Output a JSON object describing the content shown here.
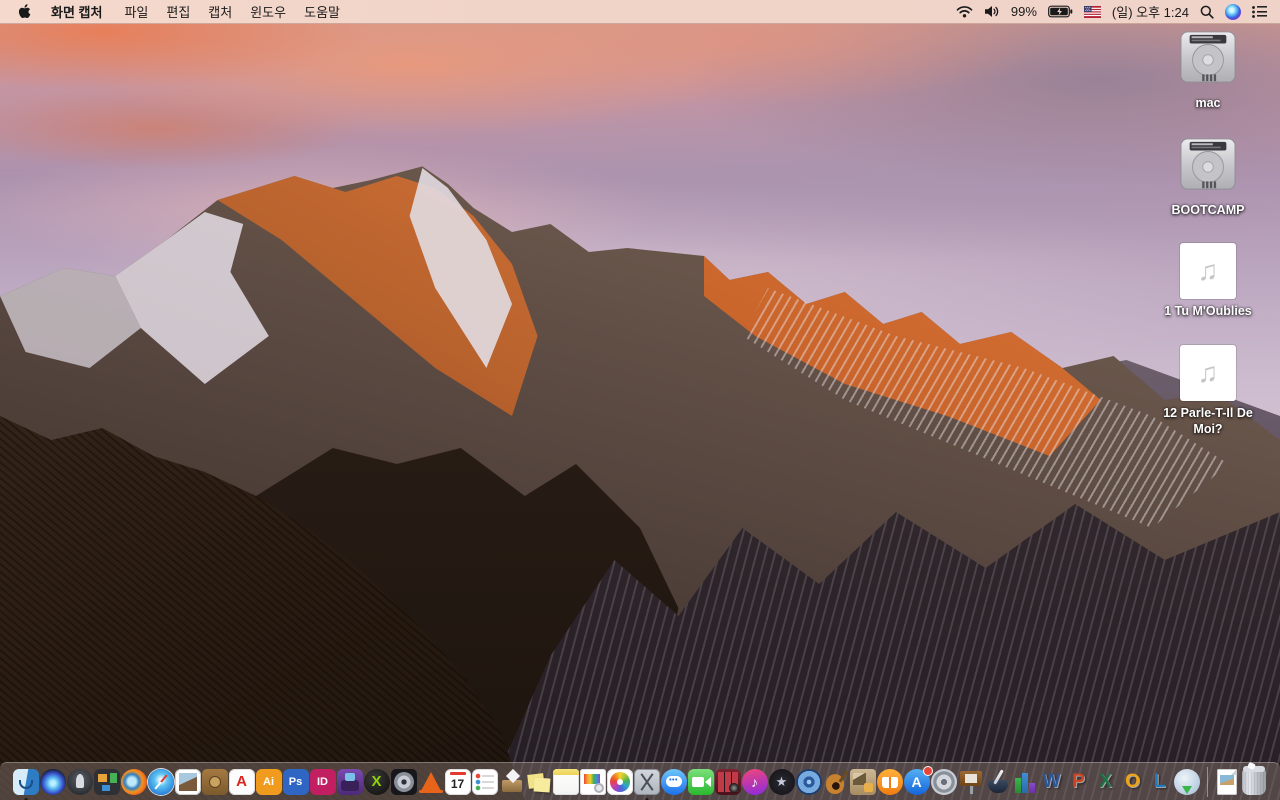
{
  "menu_bar": {
    "apple_logo_icon": "apple-logo",
    "app_name": "화면 캡처",
    "menus": [
      {
        "name": "file",
        "label": "파일"
      },
      {
        "name": "edit",
        "label": "편집"
      },
      {
        "name": "capture",
        "label": "캡처"
      },
      {
        "name": "window",
        "label": "윈도우"
      },
      {
        "name": "help",
        "label": "도움말"
      }
    ],
    "status": {
      "wifi_icon": "wifi",
      "volume_icon": "volume-on",
      "battery_percent": "99%",
      "battery_icon": "battery-charging",
      "input_source_icon": "us-flag",
      "clock": "(일) 오후 1:24",
      "search_icon": "spotlight-magnifier",
      "siri_icon": "siri-orb",
      "notification_icon": "notification-center-list"
    }
  },
  "desktop": {
    "icons": [
      {
        "name": "mac-drive",
        "label": "mac",
        "type": "hard-drive"
      },
      {
        "name": "bootcamp-drive",
        "label": "BOOTCAMP",
        "type": "hard-drive"
      },
      {
        "name": "audio-file-1",
        "label": "1 Tu M'Oublies",
        "type": "audio-file",
        "glyph": "♫"
      },
      {
        "name": "audio-file-2",
        "label": "12 Parle-T-Il De Moi?",
        "type": "audio-file",
        "glyph": "♫"
      }
    ]
  },
  "dock": {
    "items": [
      {
        "name": "finder",
        "running": true
      },
      {
        "name": "siri"
      },
      {
        "name": "launchpad"
      },
      {
        "name": "mission-control"
      },
      {
        "name": "firefox"
      },
      {
        "name": "safari"
      },
      {
        "name": "preview"
      },
      {
        "name": "contacts"
      },
      {
        "name": "acrobat-reader",
        "glyph": "A"
      },
      {
        "name": "illustrator",
        "glyph": "Ai"
      },
      {
        "name": "photoshop",
        "glyph": "Ps"
      },
      {
        "name": "indesign",
        "glyph": "ID"
      },
      {
        "name": "toast"
      },
      {
        "name": "x-media-player",
        "glyph": "X"
      },
      {
        "name": "disk-tool"
      },
      {
        "name": "vlc"
      },
      {
        "name": "calendar",
        "glyph": "17"
      },
      {
        "name": "reminders"
      },
      {
        "name": "drop-box"
      },
      {
        "name": "stickies"
      },
      {
        "name": "notes"
      },
      {
        "name": "color-document"
      },
      {
        "name": "photos"
      },
      {
        "name": "grab",
        "running": true
      },
      {
        "name": "messages",
        "glyph": "•••"
      },
      {
        "name": "facetime"
      },
      {
        "name": "photo-booth"
      },
      {
        "name": "itunes",
        "glyph": "♪"
      },
      {
        "name": "imovie",
        "glyph": "★"
      },
      {
        "name": "idvd"
      },
      {
        "name": "garageband"
      },
      {
        "name": "cards"
      },
      {
        "name": "ibooks"
      },
      {
        "name": "app-store",
        "glyph": "A",
        "badge": true
      },
      {
        "name": "system-preferences"
      },
      {
        "name": "keynote"
      },
      {
        "name": "pages"
      },
      {
        "name": "numbers"
      },
      {
        "name": "word",
        "glyph": "W"
      },
      {
        "name": "powerpoint",
        "glyph": "P"
      },
      {
        "name": "excel",
        "glyph": "X"
      },
      {
        "name": "outlook",
        "glyph": "O"
      },
      {
        "name": "lync",
        "glyph": "L"
      },
      {
        "name": "document-connection"
      },
      {
        "name": "separator",
        "separator": true
      },
      {
        "name": "downloads-file"
      },
      {
        "name": "trash"
      }
    ]
  },
  "colors": {
    "menubar_bg": "#f2d6ca",
    "menubar_text": "#1a1a1a",
    "dock_bg_rgba": "rgba(118,104,99,0.55)",
    "desktop_label_text": "#ffffff",
    "badge_red": "#e8453a",
    "sky_top_left": "#d99a85",
    "sky_right": "#ad92ae",
    "alpenglow_orange": "#cf6a2e",
    "rock_dark": "#281b11",
    "snow": "#e2dce2"
  }
}
